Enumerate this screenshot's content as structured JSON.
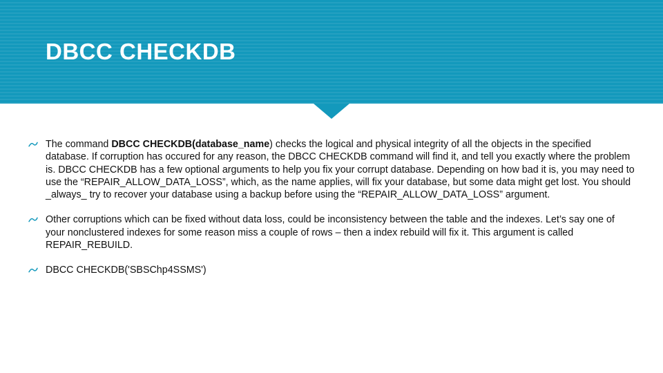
{
  "title": "DBCC CHECKDB",
  "bullets": [
    {
      "prefix": "The command  ",
      "bold_span": "DBCC CHECKDB(database_name",
      "suffix": ") checks the logical and physical integrity of all the objects in the specified database. If corruption has occured for any reason, the DBCC CHECKDB command will find it, and tell you exactly where the problem is. DBCC CHECKDB has a few optional arguments to help you fix your corrupt database. Depending on how bad it is, you may need to use the “REPAIR_ALLOW_DATA_LOSS”, which, as the name applies, will fix  your database, but some data might get lost. You should _always_ try to recover your database using a backup before using the “REPAIR_ALLOW_DATA_LOSS” argument."
    },
    {
      "text": "Other corruptions which can be fixed without data loss, could be inconsistency between the table and the indexes. Let’s say one of your nonclustered indexes for some reason miss a couple of rows – then a index rebuild will fix it. This argument is called REPAIR_REBUILD."
    },
    {
      "text": "DBCC CHECKDB('SBSChp4SSMS')"
    }
  ],
  "colors": {
    "accent": "#1399bc"
  }
}
